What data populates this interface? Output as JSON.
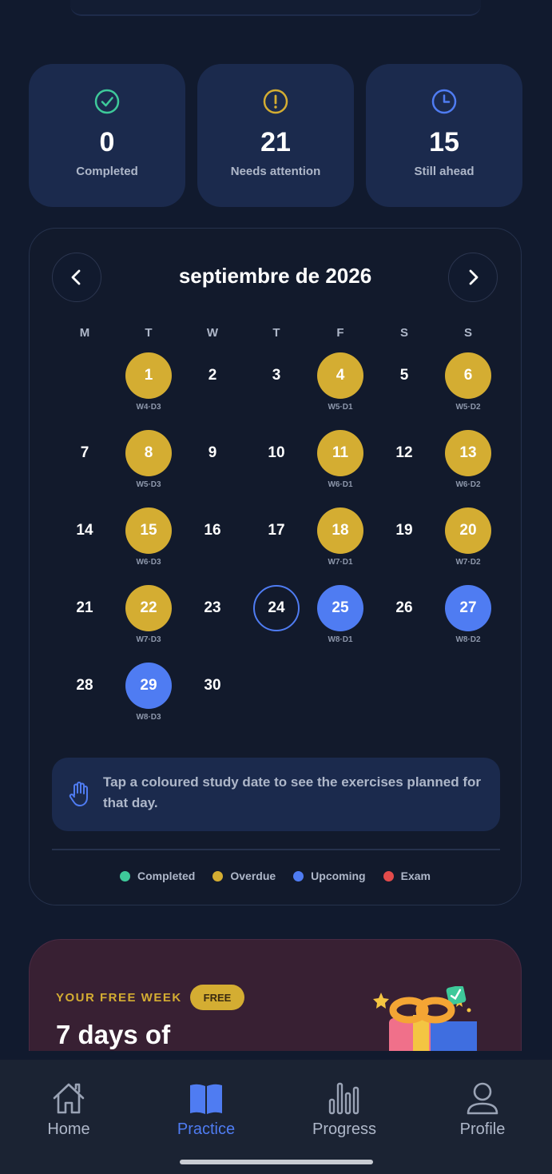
{
  "stats": [
    {
      "value": "0",
      "label": "Completed",
      "icon": "check-circle-icon",
      "color": "#3ec99a"
    },
    {
      "value": "21",
      "label": "Needs attention",
      "icon": "alert-circle-icon",
      "color": "#d4ad32"
    },
    {
      "value": "15",
      "label": "Still ahead",
      "icon": "clock-icon",
      "color": "#4f7cf2"
    }
  ],
  "calendar": {
    "month_title": "septiembre de 2026",
    "weekdays": [
      "M",
      "T",
      "W",
      "T",
      "F",
      "S",
      "S"
    ],
    "days": [
      {
        "day": "1",
        "status": "overdue",
        "tag": "W4·D3"
      },
      {
        "day": "2",
        "status": "none",
        "tag": ""
      },
      {
        "day": "3",
        "status": "none",
        "tag": ""
      },
      {
        "day": "4",
        "status": "overdue",
        "tag": "W5·D1"
      },
      {
        "day": "5",
        "status": "none",
        "tag": ""
      },
      {
        "day": "6",
        "status": "overdue",
        "tag": "W5·D2"
      },
      {
        "day": "7",
        "status": "none",
        "tag": ""
      },
      {
        "day": "8",
        "status": "overdue",
        "tag": "W5·D3"
      },
      {
        "day": "9",
        "status": "none",
        "tag": ""
      },
      {
        "day": "10",
        "status": "none",
        "tag": ""
      },
      {
        "day": "11",
        "status": "overdue",
        "tag": "W6·D1"
      },
      {
        "day": "12",
        "status": "none",
        "tag": ""
      },
      {
        "day": "13",
        "status": "overdue",
        "tag": "W6·D2"
      },
      {
        "day": "14",
        "status": "none",
        "tag": ""
      },
      {
        "day": "15",
        "status": "overdue",
        "tag": "W6·D3"
      },
      {
        "day": "16",
        "status": "none",
        "tag": ""
      },
      {
        "day": "17",
        "status": "none",
        "tag": ""
      },
      {
        "day": "18",
        "status": "overdue",
        "tag": "W7·D1"
      },
      {
        "day": "19",
        "status": "none",
        "tag": ""
      },
      {
        "day": "20",
        "status": "overdue",
        "tag": "W7·D2"
      },
      {
        "day": "21",
        "status": "none",
        "tag": ""
      },
      {
        "day": "22",
        "status": "overdue",
        "tag": "W7·D3"
      },
      {
        "day": "23",
        "status": "none",
        "tag": ""
      },
      {
        "day": "24",
        "status": "today",
        "tag": ""
      },
      {
        "day": "25",
        "status": "upcoming",
        "tag": "W8·D1"
      },
      {
        "day": "26",
        "status": "none",
        "tag": ""
      },
      {
        "day": "27",
        "status": "upcoming",
        "tag": "W8·D2"
      },
      {
        "day": "28",
        "status": "none",
        "tag": ""
      },
      {
        "day": "29",
        "status": "upcoming",
        "tag": "W8·D3"
      },
      {
        "day": "30",
        "status": "none",
        "tag": ""
      }
    ],
    "hint": "Tap a coloured study date to see the exercises planned for that day.",
    "legend": [
      {
        "label": "Completed",
        "color": "#3ec99a"
      },
      {
        "label": "Overdue",
        "color": "#d4ad32"
      },
      {
        "label": "Upcoming",
        "color": "#4f7cf2"
      },
      {
        "label": "Exam",
        "color": "#e24b4b"
      }
    ]
  },
  "promo": {
    "eyebrow": "YOUR FREE WEEK",
    "badge": "FREE",
    "headline": "7 days of"
  },
  "nav": [
    {
      "label": "Home",
      "icon": "home-icon",
      "active": false
    },
    {
      "label": "Practice",
      "icon": "book-icon",
      "active": true
    },
    {
      "label": "Progress",
      "icon": "bar-chart-icon",
      "active": false
    },
    {
      "label": "Profile",
      "icon": "user-icon",
      "active": false
    }
  ]
}
